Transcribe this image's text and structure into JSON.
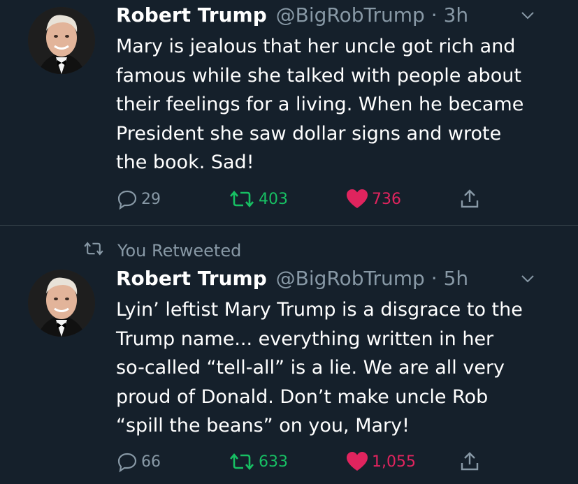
{
  "tweets": [
    {
      "author_name": "Robert Trump",
      "handle": "@BigRobTrump",
      "separator": "·",
      "time": "3h",
      "text": "Mary is jealous that her uncle got rich and\nfamous while she talked with people about\ntheir feelings for a living. When he became\nPresident she saw dollar signs and wrote\nthe book. Sad!",
      "replies": "29",
      "retweets": "403",
      "likes": "736",
      "retweeted": true,
      "liked": true
    },
    {
      "retweet_banner": "You Retweeted",
      "author_name": "Robert Trump",
      "handle": "@BigRobTrump",
      "separator": "·",
      "time": "5h",
      "text": "Lyin’ leftist Mary Trump is a disgrace to the\nTrump name... everything written in her\nso-called “tell-all” is a lie. We are all very\nproud of Donald. Don’t make uncle Rob\n“spill the beans” on you, Mary!",
      "replies": "66",
      "retweets": "633",
      "likes": "1,055",
      "retweeted": true,
      "liked": true
    }
  ],
  "colors": {
    "background": "#15202b",
    "secondary_text": "#8899a6",
    "retweet_green": "#17bf63",
    "like_pink": "#e0245e",
    "divider": "#38444d"
  },
  "icons": [
    "chevron-down-icon",
    "reply-icon",
    "retweet-icon",
    "heart-icon",
    "share-icon"
  ]
}
